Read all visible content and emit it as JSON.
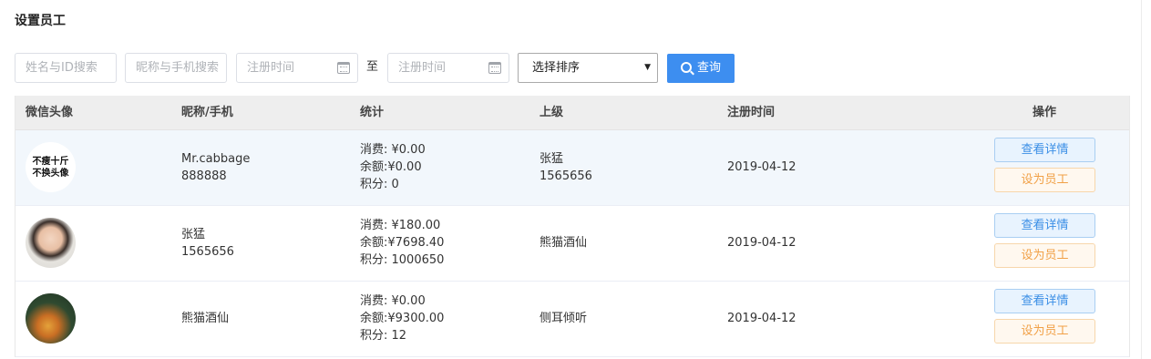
{
  "page": {
    "title": "设置员工"
  },
  "filters": {
    "name_id_placeholder": "姓名与ID搜索",
    "nick_phone_placeholder": "昵称与手机搜索",
    "reg_start_placeholder": "注册时间",
    "to_label": "至",
    "reg_end_placeholder": "注册时间",
    "sort_selected": "选择排序",
    "query_label": "查询"
  },
  "table": {
    "headers": {
      "avatar": "微信头像",
      "nick_phone": "昵称/手机",
      "stats": "统计",
      "superior": "上级",
      "reg_time": "注册时间",
      "actions": "操作"
    },
    "rows": [
      {
        "avatar_text_1": "不瘦十斤",
        "avatar_text_2": "不换头像",
        "nickname": "Mr.cabbage",
        "phone": "888888",
        "consume": "消费: ¥0.00",
        "balance": "余额:¥0.00",
        "points": "积分: 0",
        "superior_name": "张猛",
        "superior_id": "1565656",
        "reg_date": "2019-04-12",
        "detail_label": "查看详情",
        "staff_label": "设为员工"
      },
      {
        "nickname": "张猛",
        "phone": "1565656",
        "consume": "消费: ¥180.00",
        "balance": "余额:¥7698.40",
        "points": "积分: 1000650",
        "superior_name": "熊猫酒仙",
        "superior_id": "",
        "reg_date": "2019-04-12",
        "detail_label": "查看详情",
        "staff_label": "设为员工"
      },
      {
        "nickname": "熊猫酒仙",
        "phone": "",
        "consume": "消费: ¥0.00",
        "balance": "余额:¥9300.00",
        "points": "积分: 12",
        "superior_name": "侧耳倾听",
        "superior_id": "",
        "reg_date": "2019-04-12",
        "detail_label": "查看详情",
        "staff_label": "设为员工"
      }
    ]
  },
  "colors": {
    "primary": "#3d8ef0",
    "detail": "#3a8ee6",
    "staff": "#f1a046",
    "header_bg": "#eeeeee",
    "highlight_row": "#f2f7fc"
  }
}
